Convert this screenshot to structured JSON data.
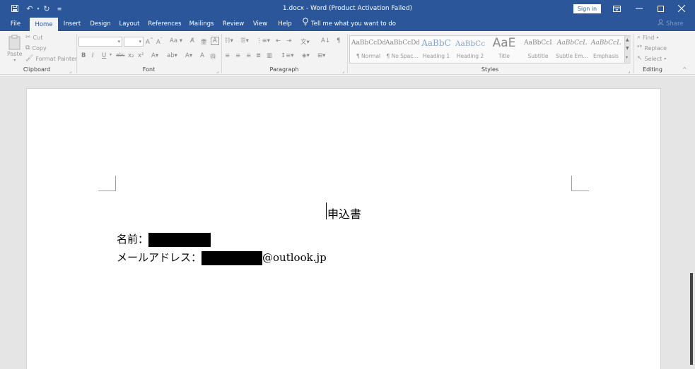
{
  "titlebar": {
    "title": "1.docx - Word (Product Activation Failed)",
    "sign_in": "Sign in",
    "icons": [
      "save-icon",
      "undo-icon",
      "redo-icon",
      "customize-icon",
      "ribbon-display-icon",
      "minimize-icon",
      "maximize-icon",
      "close-icon"
    ]
  },
  "tabs": [
    "File",
    "Home",
    "Insert",
    "Design",
    "Layout",
    "References",
    "Mailings",
    "Review",
    "View",
    "Help"
  ],
  "active_tab": "Home",
  "tell_me": "Tell me what you want to do",
  "share": "Share",
  "clipboard": {
    "label": "Clipboard",
    "paste": "Paste",
    "cut": "Cut",
    "copy": "Copy",
    "format_painter": "Format Painter"
  },
  "font": {
    "label": "Font",
    "bold": "B",
    "italic": "I",
    "underline": "U",
    "strike": "abc",
    "subscript": "x₂",
    "superscript": "x²",
    "change_case": "Aa"
  },
  "paragraph": {
    "label": "Paragraph",
    "pilcrow": "¶"
  },
  "styles": {
    "label": "Styles",
    "items": [
      {
        "preview": "AaBbCcDd",
        "name": "¶ Normal"
      },
      {
        "preview": "AaBbCcDd",
        "name": "¶ No Spac..."
      },
      {
        "preview": "AaBbC",
        "name": "Heading 1"
      },
      {
        "preview": "AaBbCc",
        "name": "Heading 2"
      },
      {
        "preview": "AaE",
        "name": "Title"
      },
      {
        "preview": "AaBbCcI",
        "name": "Subtitle"
      },
      {
        "preview": "AaBbCcL",
        "name": "Subtle Em..."
      },
      {
        "preview": "AaBbCcL",
        "name": "Emphasis"
      }
    ]
  },
  "editing": {
    "label": "Editing",
    "find": "Find",
    "replace": "Replace",
    "select": "Select"
  },
  "document": {
    "heading": "申込書",
    "name_label": "名前：",
    "email_label": "メールアドレス：",
    "email_domain": "@outlook.jp"
  },
  "colors": {
    "brand_blue": "#2b579a",
    "ribbon_bg": "#f3f3f3",
    "workspace_bg": "#e5e5e5",
    "redaction": "#000000"
  }
}
